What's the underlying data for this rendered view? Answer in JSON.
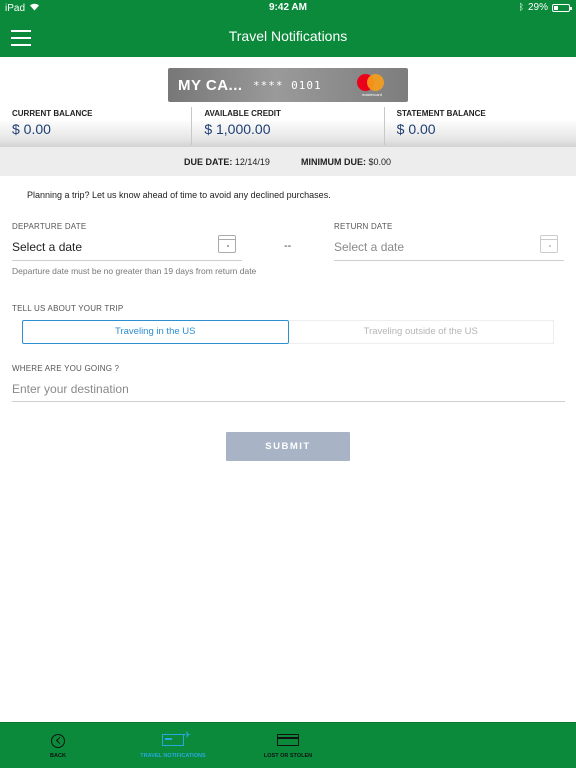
{
  "status_bar": {
    "device": "iPad",
    "time": "9:42 AM",
    "battery": "29%",
    "battery_level": 0.29
  },
  "header": {
    "title": "Travel Notifications",
    "menu_icon": "hamburger-menu-icon"
  },
  "card": {
    "name": "MY CA...",
    "number": "**** 0101",
    "brand": "mastercard"
  },
  "balances": [
    {
      "label": "CURRENT BALANCE",
      "value": "$ 0.00"
    },
    {
      "label": "AVAILABLE CREDIT",
      "value": "$ 1,000.00"
    },
    {
      "label": "STATEMENT BALANCE",
      "value": "$ 0.00"
    }
  ],
  "due": {
    "due_label": "DUE DATE:",
    "due_value": "12/14/19",
    "min_label": "MINIMUM DUE:",
    "min_value": "$0.00"
  },
  "intro": "Planning a trip? Let us know ahead of time to avoid any declined purchases.",
  "departure": {
    "label": "DEPARTURE DATE",
    "value": "Select a date",
    "hint": "Departure date must be no greater than 19 days from return date"
  },
  "separator": "--",
  "return": {
    "label": "RETURN DATE",
    "value": "Select a date"
  },
  "trip": {
    "label": "TELL US ABOUT YOUR TRIP",
    "options": [
      "Traveling in the US",
      "Traveling outside of the US"
    ],
    "selected": "Traveling in the US"
  },
  "destination": {
    "label": "WHERE ARE YOU GOING ?",
    "placeholder": "Enter your destination"
  },
  "submit_label": "SUBMIT",
  "tabs": [
    {
      "label": "BACK",
      "icon": "back-icon"
    },
    {
      "label": "TRAVEL NOTIFICATIONS",
      "icon": "card-plane-icon",
      "active": true
    },
    {
      "label": "LOST OR STOLEN",
      "icon": "card-icon"
    }
  ],
  "colors": {
    "brand_green": "#0a8a3a",
    "accent_blue": "#2d8fd0",
    "balance_blue": "#1f3f73",
    "submit_disabled": "#a8b4c6"
  }
}
